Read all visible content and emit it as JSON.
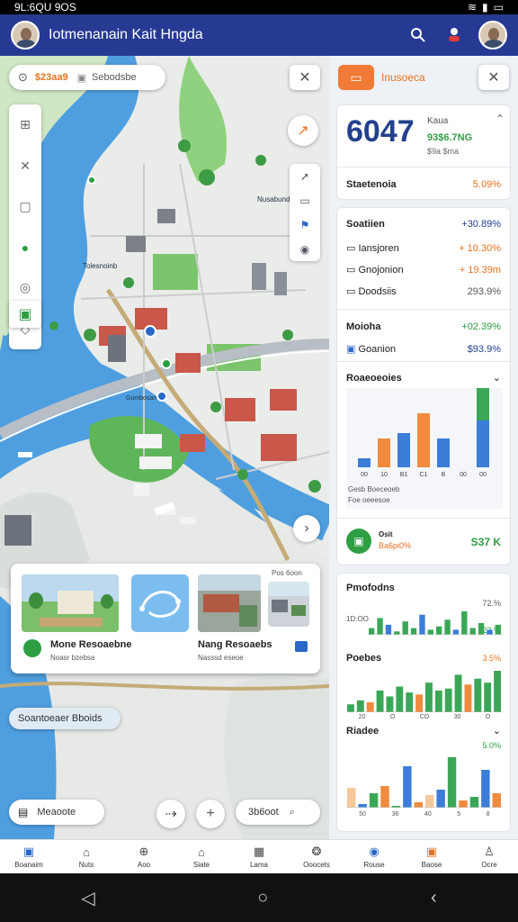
{
  "status_bar": {
    "time": "9L:6QU 9OS",
    "icons": [
      "wifi",
      "signal",
      "battery"
    ]
  },
  "app_bar": {
    "title": "Iotmenanain Kait Hngda",
    "icons": [
      "search-icon",
      "notification-icon",
      "profile-avatar"
    ]
  },
  "map": {
    "search_pill": {
      "price": "$23aa9",
      "label": "Sebodsbe"
    },
    "close_label": "✕",
    "left_tools": [
      "layers-icon",
      "close-icon",
      "frame-icon",
      "location-icon",
      "target-icon",
      "tag-icon",
      "active-layer-icon"
    ],
    "right_tools": [
      "direction-icon",
      "list-icon",
      "flag-icon",
      "settings-icon"
    ],
    "map_labels": [
      "Tolesnoinb",
      "Nusabunds",
      "Gumbosam"
    ],
    "cards": [
      {
        "title": "Mone Resoaebne",
        "subtitle": "Noasr bzebsa"
      },
      {
        "title": "",
        "subtitle": ""
      },
      {
        "title": "Nang Resoaebs",
        "subtitle": "Nasssd eseoe"
      },
      {
        "title": "",
        "subtitle": "Pos 6oon"
      }
    ],
    "chip_label": "Soantoeaer Bboids",
    "bottom_left_label": "Meaoote",
    "bottom_right_label": "3b6oot",
    "zoom_out": "⇢",
    "zoom_in": "+"
  },
  "panel": {
    "header_title": "Inusoeca",
    "big_number": "6047",
    "big_caption": "Kaua",
    "big_sub": "93$6.7NG",
    "big_sub2": "$9a $ma",
    "summary": {
      "label": "Staetenoia",
      "value": "5.09%"
    },
    "list_title": {
      "label": "Soatiien",
      "value": "+30.89%"
    },
    "list_items": [
      {
        "label": "Iansjoren",
        "value": "+ 10.30%"
      },
      {
        "label": "Gnojonion",
        "value": "+ 19.39m"
      },
      {
        "label": "Doodsiis",
        "value": "293.9%"
      }
    ],
    "metric_row": {
      "label": "Moioha",
      "value": "+02.39%"
    },
    "metric_row2": {
      "label": "Goanion",
      "value": "$93.9%"
    },
    "chart1_title": "Roaeoeoies",
    "chart1_caption": "Gesb Boeceoeb",
    "chart1_caption2": "Foe oeeesoe",
    "chart1_ticks": [
      "00",
      "10",
      "B1",
      "C1",
      "B",
      "00",
      "00"
    ],
    "badge": {
      "label": "Osit",
      "sub": "Ba6pi0%",
      "value": "S37 K"
    },
    "chart2_title": "Pmofodns",
    "chart2_pct": "72.%",
    "chart2_pct2": "23.%",
    "chart2_label": "1D:OO",
    "chart3_title": "Poebes",
    "chart3_pct": "3.5%",
    "chart3_ticks": [
      "20",
      "O",
      "CO",
      "30",
      "O"
    ],
    "chart4_title": "Riadee",
    "chart4_pct": "5.0%",
    "chart4_ticks": [
      "50",
      "36",
      "40",
      "5",
      "8"
    ]
  },
  "chart_data": [
    {
      "type": "bar",
      "title": "Roaeoeoies",
      "series": [
        {
          "color": "#3b7dd8",
          "values": [
            10,
            0,
            38,
            0,
            32,
            0,
            52
          ]
        },
        {
          "color": "#f08a3c",
          "values": [
            0,
            32,
            0,
            60,
            0,
            0,
            0
          ]
        },
        {
          "color": "#3aa757",
          "values": [
            0,
            0,
            0,
            0,
            0,
            0,
            76
          ]
        }
      ],
      "categories": [
        "00",
        "10",
        "B1",
        "C1",
        "B",
        "00",
        "00"
      ]
    },
    {
      "type": "bar",
      "title": "Pmofodns",
      "values": [
        4,
        10,
        6,
        2,
        8,
        4,
        12,
        3,
        5,
        9,
        3,
        14,
        4,
        7,
        3,
        6
      ]
    },
    {
      "type": "bar",
      "title": "Poebes",
      "values": [
        8,
        12,
        10,
        22,
        16,
        26,
        20,
        18,
        30,
        22,
        24,
        38,
        28,
        34,
        30,
        42
      ]
    },
    {
      "type": "bar",
      "title": "Riadee",
      "values": [
        22,
        4,
        16,
        24,
        2,
        46,
        6,
        14,
        20,
        56,
        8,
        12,
        42,
        16
      ]
    }
  ],
  "bottom_nav": [
    {
      "label": "Boanaim",
      "icon": "home-icon"
    },
    {
      "label": "Nuts",
      "icon": "house-icon"
    },
    {
      "label": "Aoo",
      "icon": "search-icon"
    },
    {
      "label": "Siate",
      "icon": "building-icon"
    },
    {
      "label": "Lama",
      "icon": "grid-icon"
    },
    {
      "label": "Ooocets",
      "icon": "gallery-icon"
    },
    {
      "label": "Rouse",
      "icon": "time-icon"
    },
    {
      "label": "Baose",
      "icon": "photo-icon"
    },
    {
      "label": "Ocre",
      "icon": "user-icon"
    }
  ],
  "colors": {
    "appbar": "#273a93",
    "accent_orange": "#f07a36",
    "accent_green": "#2e9e43",
    "accent_blue": "#3b7dd8",
    "water": "#4f9fe0"
  }
}
